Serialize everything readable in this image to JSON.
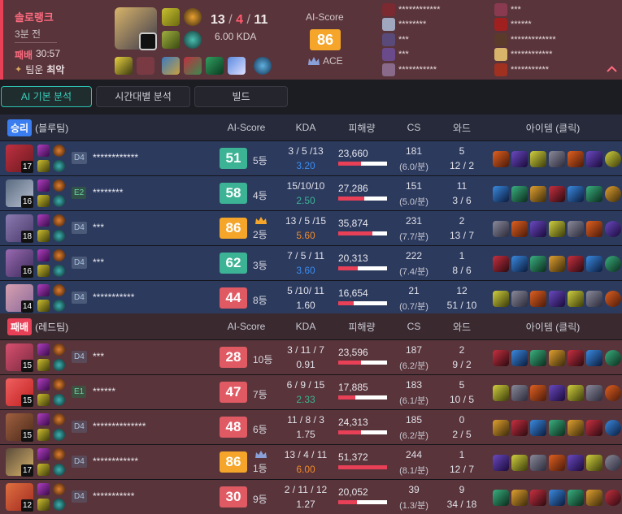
{
  "match": {
    "queue": "솔로랭크",
    "ago": "3분 전",
    "result": "패배",
    "duration": "30:57",
    "tilt_label": "팀운",
    "tilt_value": "최악",
    "kills": "13",
    "deaths": "4",
    "assists": "11",
    "sep": "/",
    "kda_ratio": "6.00 KDA",
    "ai_label": "AI-Score",
    "ai_score": "86",
    "badge": "ACE",
    "expand_icon": "chevron-up-icon",
    "accent": "#e84057"
  },
  "roster": {
    "left": [
      "************",
      "********",
      "***",
      "***",
      "***********"
    ],
    "right": [
      "***",
      "******",
      "*************",
      "************",
      "***********"
    ]
  },
  "tabs": [
    {
      "label": "AI 기본 분석"
    },
    {
      "label": "시간대별 분석"
    },
    {
      "label": "빌드"
    }
  ],
  "columns": {
    "ai_score": "AI-Score",
    "kda": "KDA",
    "damage": "피해량",
    "cs": "CS",
    "wards": "와드",
    "items": "아이템 (클릭)"
  },
  "blue_team": {
    "result": "승리",
    "team": "(블루팀)",
    "players": [
      {
        "level": "17",
        "tier": "D4",
        "name": "************",
        "score": "51",
        "rank": "5등",
        "kda": "3 / 5 /13",
        "ratio": "3.20",
        "damage": "23,660",
        "damage_frac": 0.46,
        "cs": "181",
        "csm": "(6.0/분)",
        "wards": "5",
        "wards2": "12 / 2"
      },
      {
        "level": "16",
        "tier": "E2",
        "name": "********",
        "score": "58",
        "rank": "4등",
        "kda": "15/10/10",
        "ratio": "2.50",
        "damage": "27,286",
        "damage_frac": 0.53,
        "cs": "151",
        "csm": "(5.0/분)",
        "wards": "11",
        "wards2": "3 / 6"
      },
      {
        "level": "18",
        "tier": "D4",
        "name": "***",
        "score": "86",
        "rank": "2등",
        "kda": "13 / 5 /15",
        "ratio": "5.60",
        "damage": "35,874",
        "damage_frac": 0.7,
        "cs": "231",
        "csm": "(7.7/분)",
        "wards": "2",
        "wards2": "13 / 7"
      },
      {
        "level": "16",
        "tier": "D4",
        "name": "***",
        "score": "62",
        "rank": "3등",
        "kda": "7 / 5 / 11",
        "ratio": "3.60",
        "damage": "20,313",
        "damage_frac": 0.4,
        "cs": "222",
        "csm": "(7.4/분)",
        "wards": "1",
        "wards2": "8 / 6"
      },
      {
        "level": "14",
        "tier": "D4",
        "name": "***********",
        "score": "44",
        "rank": "8등",
        "kda": "5 /10/ 11",
        "ratio": "1.60",
        "damage": "16,654",
        "damage_frac": 0.32,
        "cs": "21",
        "csm": "(0.7/분)",
        "wards": "12",
        "wards2": "51 / 10"
      }
    ]
  },
  "red_team": {
    "result": "패배",
    "team": "(레드팀)",
    "players": [
      {
        "level": "15",
        "tier": "D4",
        "name": "***",
        "score": "28",
        "rank": "10등",
        "kda": "3 / 11 / 7",
        "ratio": "0.91",
        "damage": "23,596",
        "damage_frac": 0.46,
        "cs": "187",
        "csm": "(6.2/분)",
        "wards": "2",
        "wards2": "9 / 2"
      },
      {
        "level": "15",
        "tier": "E1",
        "name": "******",
        "score": "47",
        "rank": "7등",
        "kda": "6 / 9 / 15",
        "ratio": "2.33",
        "damage": "17,885",
        "damage_frac": 0.35,
        "cs": "183",
        "csm": "(6.1/분)",
        "wards": "5",
        "wards2": "10 / 5"
      },
      {
        "level": "15",
        "tier": "D4",
        "name": "**************",
        "score": "48",
        "rank": "6등",
        "kda": "11 / 8 / 3",
        "ratio": "1.75",
        "damage": "24,313",
        "damage_frac": 0.47,
        "cs": "185",
        "csm": "(6.2/분)",
        "wards": "0",
        "wards2": "2 / 5"
      },
      {
        "level": "17",
        "tier": "D4",
        "name": "************",
        "score": "86",
        "rank": "1등",
        "kda": "13 / 4 / 11",
        "ratio": "6.00",
        "damage": "51,372",
        "damage_frac": 1.0,
        "cs": "244",
        "csm": "(8.1/분)",
        "wards": "1",
        "wards2": "12 / 7"
      },
      {
        "level": "12",
        "tier": "D4",
        "name": "***********",
        "score": "30",
        "rank": "9등",
        "kda": "2 / 11 / 12",
        "ratio": "1.27",
        "damage": "20,052",
        "damage_frac": 0.39,
        "cs": "39",
        "csm": "(1.3/분)",
        "wards": "9",
        "wards2": "34 / 18"
      }
    ]
  }
}
